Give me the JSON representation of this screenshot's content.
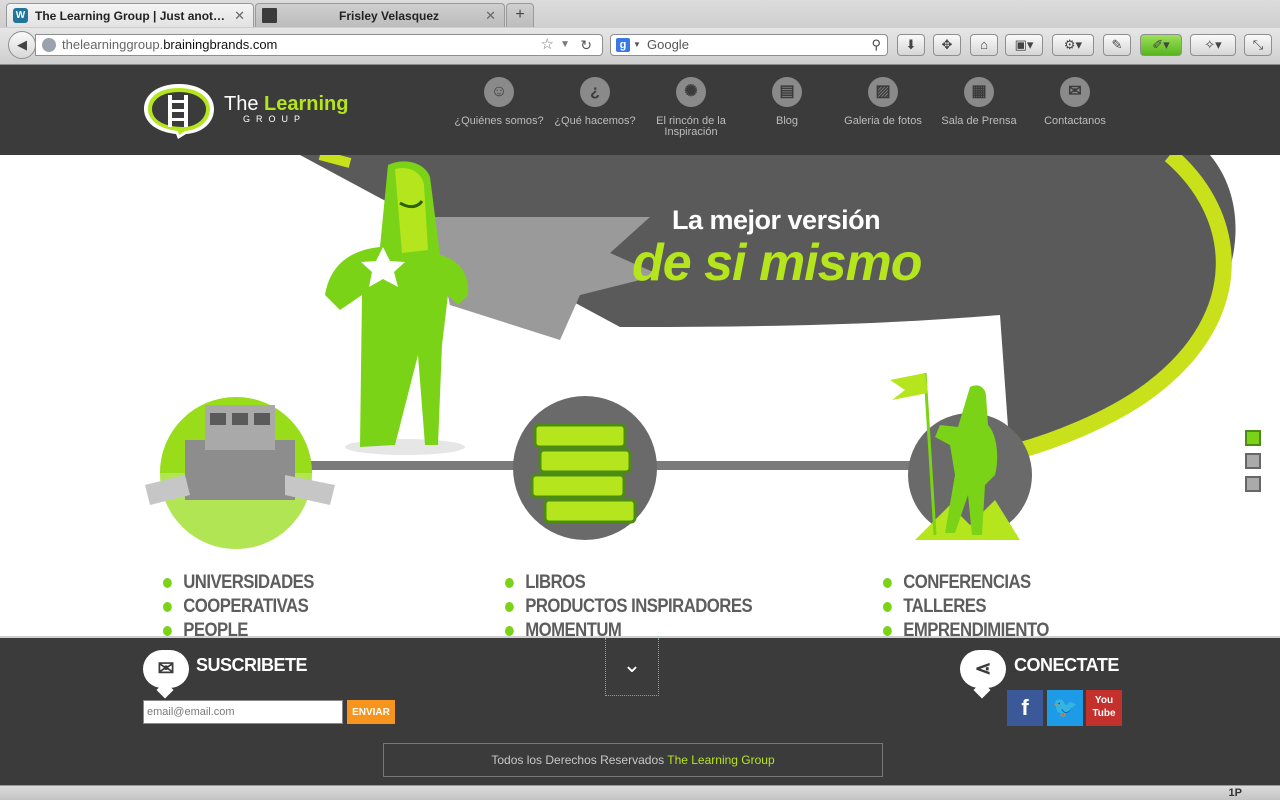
{
  "browser": {
    "tabs": [
      {
        "title": "The Learning Group | Just anot…",
        "active": true,
        "favicon": "wordpress-icon"
      },
      {
        "title": "Frisley Velasquez",
        "active": false,
        "favicon": "page-icon"
      }
    ],
    "new_tab_label": "+",
    "url_scheme": "thelearninggroup.",
    "url_host": "brainingbrands.com",
    "search_placeholder": "Google",
    "status_right": "1P"
  },
  "site": {
    "logo_text_white": "The ",
    "logo_text_green": "Learning",
    "logo_subtext": "GROUP",
    "nav": [
      {
        "label": "¿Quiénes somos?",
        "icon": "person-icon"
      },
      {
        "label": "¿Qué hacemos?",
        "icon": "question-icon"
      },
      {
        "label": "El rincón de la Inspiración",
        "icon": "lightbulb-icon"
      },
      {
        "label": "Blog",
        "icon": "document-icon"
      },
      {
        "label": "Galeria de fotos",
        "icon": "photo-icon"
      },
      {
        "label": "Sala de Prensa",
        "icon": "press-icon"
      },
      {
        "label": "Contactanos",
        "icon": "envelope-icon"
      }
    ],
    "hero": {
      "tagline_line1": "La mejor versión",
      "tagline_line2": "de si mismo",
      "slider_count": 3,
      "slider_active": 0
    },
    "columns": [
      {
        "items": [
          "UNIVERSIDADES",
          "COOPERATIVAS",
          "PEOPLE"
        ]
      },
      {
        "items": [
          "LIBROS",
          "PRODUCTOS INSPIRADORES",
          "MOMENTUM"
        ]
      },
      {
        "items": [
          "CONFERENCIAS",
          "TALLERES",
          "EMPRENDIMIENTO"
        ]
      }
    ],
    "footer": {
      "subscribe_title": "SUSCRIBETE",
      "email_placeholder": "email@email.com",
      "send_label": "ENVIAR",
      "connect_title": "CONECTATE",
      "social": [
        {
          "name": "facebook",
          "glyph": "f",
          "color": "#3b5998"
        },
        {
          "name": "twitter",
          "glyph": "t",
          "color": "#1d9be6"
        },
        {
          "name": "youtube",
          "glyph": "You Tube",
          "color": "#c4302b"
        }
      ],
      "copyright_text": "Todos los Derechos Reservados ",
      "copyright_brand": "The Learning Group"
    },
    "colors": {
      "accent_green": "#b5e61d",
      "bright_green": "#7ad317",
      "dark_gray": "#3b3b3b",
      "orange": "#f7941d"
    }
  }
}
